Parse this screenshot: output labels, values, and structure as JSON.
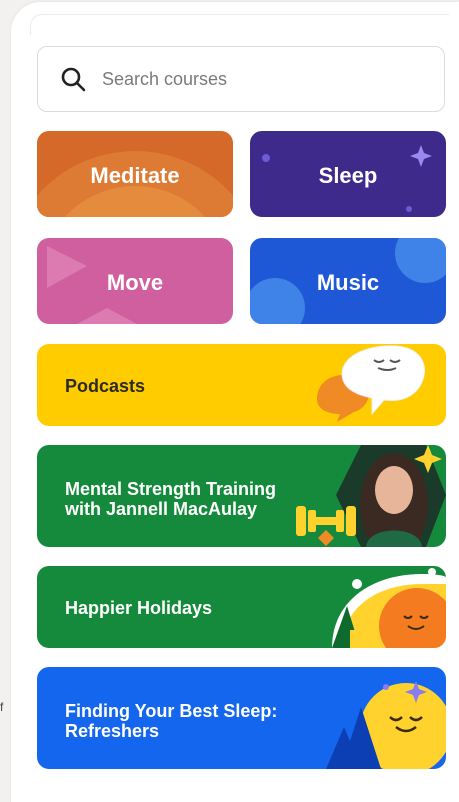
{
  "search": {
    "placeholder": "Search courses"
  },
  "categories": [
    {
      "label": "Meditate",
      "color": "#d4692a"
    },
    {
      "label": "Sleep",
      "color": "#3d2a8a"
    },
    {
      "label": "Move",
      "color": "#cf5f9e"
    },
    {
      "label": "Music",
      "color": "#1f58d6"
    }
  ],
  "courses": [
    {
      "line1": "Podcasts",
      "line2": "",
      "color": "#ffcc00",
      "text_color": "#2b2b2b"
    },
    {
      "line1": "Mental Strength Training",
      "line2": "with Jannell MacAulay",
      "color": "#168a3c",
      "text_color": "#ffffff"
    },
    {
      "line1": "Happier Holidays",
      "line2": "",
      "color": "#168a3c",
      "text_color": "#ffffff"
    },
    {
      "line1": "Finding Your Best Sleep:",
      "line2": "Refreshers",
      "color": "#1566ee",
      "text_color": "#ffffff"
    }
  ],
  "edge_glyph": "f"
}
